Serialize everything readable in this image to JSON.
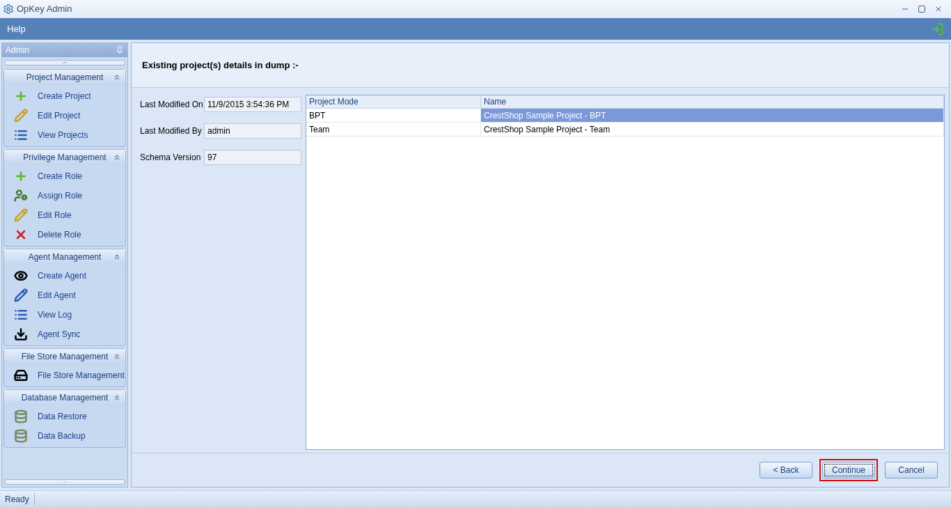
{
  "window": {
    "title": "OpKey Admin"
  },
  "menu": [
    "Help"
  ],
  "sidebar": {
    "title": "Admin",
    "groups": [
      {
        "title": "Project Management",
        "expanded": true,
        "items": [
          "Create Project",
          "Edit Project",
          "View Projects"
        ]
      },
      {
        "title": "Privilege Management",
        "expanded": true,
        "items": [
          "Create Role",
          "Assign Role",
          "Edit Role",
          "Delete Role"
        ]
      },
      {
        "title": "Agent Management",
        "expanded": true,
        "items": [
          "Create Agent",
          "Edit Agent",
          "View Log",
          "Agent Sync"
        ]
      },
      {
        "title": "File Store Management",
        "expanded": true,
        "items": [
          "File Store Management"
        ]
      },
      {
        "title": "Database Management",
        "expanded": true,
        "items": [
          "Data Restore",
          "Data Backup"
        ]
      }
    ]
  },
  "heading": "Existing project(s) details in dump :-",
  "fields": [
    {
      "label": "Last Modified On",
      "value": "11/9/2015 3:54:36 PM"
    },
    {
      "label": "Last Modified By",
      "value": "admin"
    },
    {
      "label": "Schema Version",
      "value": "97"
    }
  ],
  "table": {
    "columns": [
      "Project Mode",
      "Name"
    ],
    "rows": [
      {
        "cells": [
          "BPT",
          "CrestShop Sample Project - BPT"
        ],
        "selected": true
      },
      {
        "cells": [
          "Team",
          "CrestShop Sample Project - Team"
        ],
        "selected": false
      }
    ]
  },
  "buttons": [
    {
      "label": "< Back",
      "focused": false,
      "highlighted": false
    },
    {
      "label": "Continue",
      "focused": true,
      "highlighted": true
    },
    {
      "label": "Cancel",
      "focused": false,
      "highlighted": false
    }
  ],
  "status_bar": "Ready"
}
